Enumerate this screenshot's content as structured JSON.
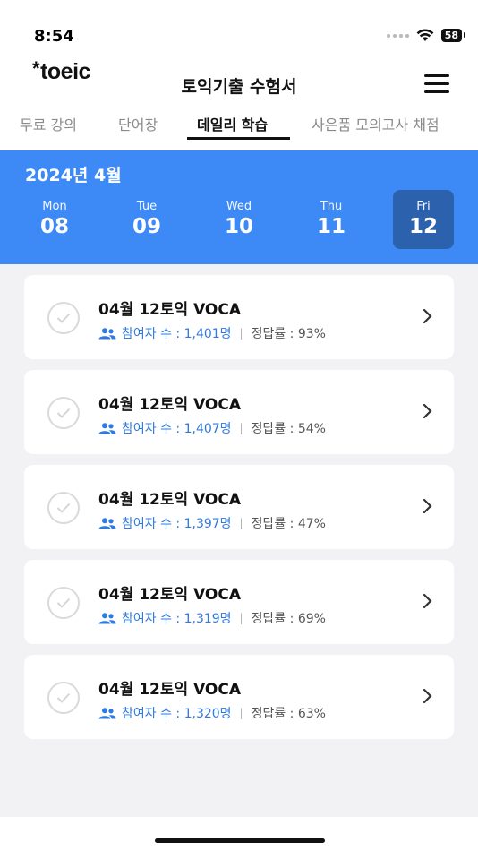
{
  "status_bar": {
    "time": "8:54",
    "battery": "58"
  },
  "header": {
    "logo": "toeic",
    "title": "토익기출 수험서"
  },
  "tabs": [
    {
      "label": "무료 강의"
    },
    {
      "label": "단어장"
    },
    {
      "label": "데일리 학습",
      "active": true
    },
    {
      "label": "사은품 모의고사 채점"
    }
  ],
  "calendar": {
    "month": "2024년 4월",
    "days": [
      {
        "dow": "Mon",
        "num": "08"
      },
      {
        "dow": "Tue",
        "num": "09"
      },
      {
        "dow": "Wed",
        "num": "10"
      },
      {
        "dow": "Thu",
        "num": "11"
      },
      {
        "dow": "Fri",
        "num": "12",
        "selected": true
      }
    ],
    "colors": {
      "panel": "#3d8af7",
      "selected": "#2c62ad"
    }
  },
  "cards": [
    {
      "title": "04월 12토익 VOCA",
      "participants": "참여자 수 : 1,401명",
      "rate": "정답률 : 93%"
    },
    {
      "title": "04월 12토익 VOCA",
      "participants": "참여자 수 : 1,407명",
      "rate": "정답률 : 54%"
    },
    {
      "title": "04월 12토익 VOCA",
      "participants": "참여자 수 : 1,397명",
      "rate": "정답률 : 47%"
    },
    {
      "title": "04월 12토익 VOCA",
      "participants": "참여자 수 : 1,319명",
      "rate": "정답률 : 69%"
    },
    {
      "title": "04월 12토익 VOCA",
      "participants": "참여자 수 : 1,320명",
      "rate": "정답률 : 63%"
    }
  ],
  "icons": {
    "status": [
      "signal-dots-icon",
      "wifi-icon",
      "battery-icon"
    ],
    "header": [
      "menu-icon"
    ],
    "card": [
      "check-circle-icon",
      "people-icon",
      "chevron-right-icon"
    ]
  }
}
